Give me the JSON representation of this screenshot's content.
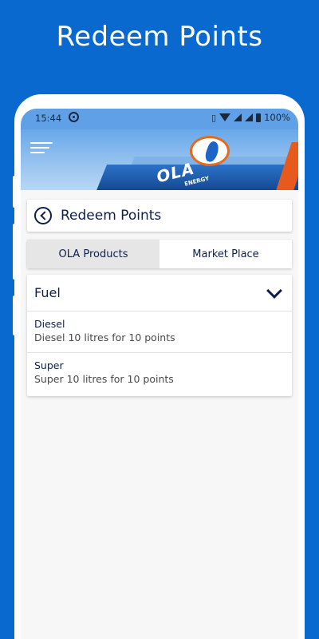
{
  "promo": {
    "title": "Redeem Points"
  },
  "status_bar": {
    "time": "15:44",
    "battery": "100%",
    "sync_icon": "sync-icon",
    "vibrate_icon": "vibrate-icon",
    "wifi_icon": "wifi-icon",
    "signal_icon": "signal-icon",
    "battery_icon": "battery-icon"
  },
  "header": {
    "logo_text": "OLA",
    "logo_sub": "ENERGY",
    "menu_icon": "hamburger-menu-icon"
  },
  "page": {
    "title": "Redeem Points",
    "back_icon": "back-arrow-icon"
  },
  "tabs": [
    {
      "label": "OLA Products",
      "active": true
    },
    {
      "label": "Market Place",
      "active": false
    }
  ],
  "category": {
    "title": "Fuel",
    "chevron_icon": "chevron-down-icon",
    "items": [
      {
        "name": "Diesel",
        "description": "Diesel 10 litres for 10 points"
      },
      {
        "name": "Super",
        "description": "Super 10 litres for 10 points"
      }
    ]
  },
  "colors": {
    "brand_blue": "#0a69cf",
    "text_navy": "#0e1f4d",
    "accent_orange": "#e65a1e"
  }
}
